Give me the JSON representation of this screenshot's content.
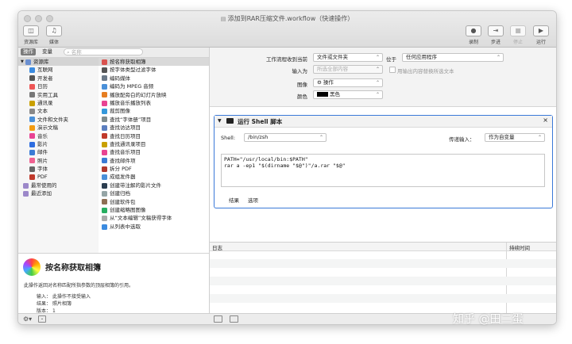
{
  "window": {
    "title": "添加到RAR压缩文件.workflow（快速操作）"
  },
  "toolbar": {
    "left": [
      {
        "label": "资源库",
        "icon": "library-icon"
      },
      {
        "label": "媒体",
        "icon": "media-icon"
      }
    ],
    "right": [
      {
        "label": "录制",
        "icon": "record-icon",
        "enabled": true
      },
      {
        "label": "步进",
        "icon": "step-icon",
        "enabled": true
      },
      {
        "label": "停止",
        "icon": "stop-icon",
        "enabled": false
      },
      {
        "label": "运行",
        "icon": "run-icon",
        "enabled": true
      }
    ]
  },
  "filter": {
    "tab_actions": "操作",
    "tab_variables": "变量",
    "search_placeholder": "名称"
  },
  "library": {
    "root": "资源库",
    "items": [
      "互联网",
      "开发者",
      "日历",
      "实用工具",
      "通讯录",
      "文本",
      "文件和文件夹",
      "演示文稿",
      "音乐",
      "影片",
      "邮件",
      "照片",
      "字体",
      "PDF"
    ],
    "extra": [
      "最常使用的",
      "最近添加"
    ]
  },
  "actions": {
    "selected": "按名称获取相簿",
    "items": [
      "按名称获取相簿",
      "按字体类型过滤字体",
      "编码媒体",
      "编码为 MPEG 音频",
      "播放配旁白的幻灯片放映",
      "播放音乐播放列表",
      "裁剪图像",
      "查找“字体册”项目",
      "查找访达项目",
      "查找日历项目",
      "查找通讯录项目",
      "查找音乐项目",
      "查找邮件项",
      "拆分 PDF",
      "成组发件器",
      "创建带注解的影片文件",
      "创建归档",
      "创建软件包",
      "创建缩略图图像",
      "从“文本编辑”文稿获得字体",
      "从列表中选取"
    ]
  },
  "description": {
    "title": "按名称获取相簿",
    "text": "此操作返回对名称匹配所指参数的顶层相簿的引用。",
    "input_label": "输入：",
    "input_value": "此操作不接受输入",
    "result_label": "结果：",
    "result_value": "照片相簿",
    "version_label": "版本：",
    "version_value": "1"
  },
  "workflow": {
    "receives_label": "工作流程收到当前",
    "receives_value": "文件或文件夹",
    "location_label": "位于",
    "location_value": "任何应用程序",
    "input_label": "输入为",
    "input_value": "所选全部内容",
    "replace_label": "用输出内容替换所选文本",
    "image_label": "图像",
    "image_value": "操作",
    "color_label": "颜色",
    "color_value": "黑色"
  },
  "shell_action": {
    "title": "运行 Shell 脚本",
    "shell_label": "Shell:",
    "shell_value": "/bin/zsh",
    "pass_label": "传递输入：",
    "pass_value": "作为自变量",
    "code": "PATH=\"/usr/local/bin:$PATH\"\nrar a -ep1 \"$(dirname \"$@\")\"/a.rar \"$@\"",
    "tab_results": "结果",
    "tab_options": "选项"
  },
  "log": {
    "col_log": "日志",
    "col_duration": "持续时间"
  },
  "watermark": "知乎 @田二蛋"
}
